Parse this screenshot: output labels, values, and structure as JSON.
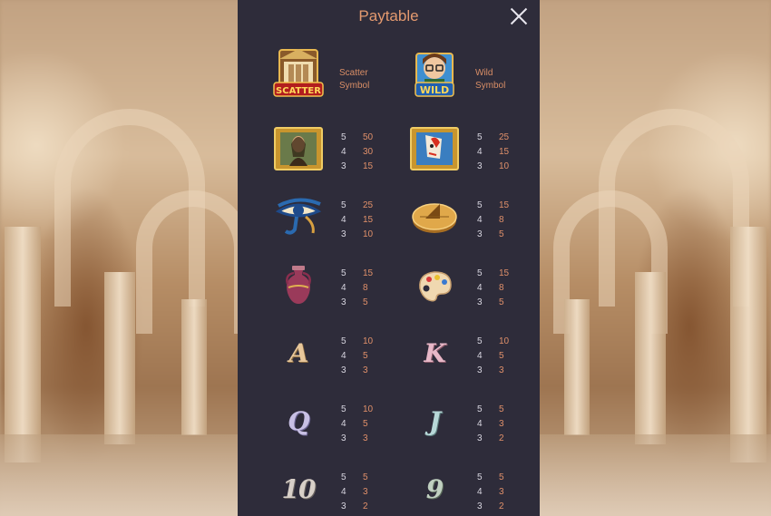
{
  "header": {
    "title": "Paytable"
  },
  "close_icon": "close-icon",
  "colors": {
    "panel": "#2e2c3a",
    "accent": "#e0906a",
    "count": "#d8d6e0"
  },
  "special": {
    "scatter": {
      "label": "SCATTER",
      "desc_line1": "Scatter",
      "desc_line2": "Symbol"
    },
    "wild": {
      "label": "WILD",
      "desc_line1": "Wild",
      "desc_line2": "Symbol"
    }
  },
  "symbols": [
    {
      "name": "mona-lisa-painting",
      "pays": [
        [
          "5",
          "50"
        ],
        [
          "4",
          "30"
        ],
        [
          "3",
          "15"
        ]
      ]
    },
    {
      "name": "abstract-portrait-painting",
      "pays": [
        [
          "5",
          "25"
        ],
        [
          "4",
          "15"
        ],
        [
          "3",
          "10"
        ]
      ]
    },
    {
      "name": "eye-of-horus",
      "pays": [
        [
          "5",
          "25"
        ],
        [
          "4",
          "15"
        ],
        [
          "3",
          "10"
        ]
      ]
    },
    {
      "name": "sundial",
      "pays": [
        [
          "5",
          "15"
        ],
        [
          "4",
          "8"
        ],
        [
          "3",
          "5"
        ]
      ]
    },
    {
      "name": "amphora-vase",
      "pays": [
        [
          "5",
          "15"
        ],
        [
          "4",
          "8"
        ],
        [
          "3",
          "5"
        ]
      ]
    },
    {
      "name": "paint-palette",
      "pays": [
        [
          "5",
          "15"
        ],
        [
          "4",
          "8"
        ],
        [
          "3",
          "5"
        ]
      ]
    },
    {
      "name": "A",
      "pays": [
        [
          "5",
          "10"
        ],
        [
          "4",
          "5"
        ],
        [
          "3",
          "3"
        ]
      ]
    },
    {
      "name": "K",
      "pays": [
        [
          "5",
          "10"
        ],
        [
          "4",
          "5"
        ],
        [
          "3",
          "3"
        ]
      ]
    },
    {
      "name": "Q",
      "pays": [
        [
          "5",
          "10"
        ],
        [
          "4",
          "5"
        ],
        [
          "3",
          "3"
        ]
      ]
    },
    {
      "name": "J",
      "pays": [
        [
          "5",
          "5"
        ],
        [
          "4",
          "3"
        ],
        [
          "3",
          "2"
        ]
      ]
    },
    {
      "name": "10",
      "pays": [
        [
          "5",
          "5"
        ],
        [
          "4",
          "3"
        ],
        [
          "3",
          "2"
        ]
      ]
    },
    {
      "name": "9",
      "pays": [
        [
          "5",
          "5"
        ],
        [
          "4",
          "3"
        ],
        [
          "3",
          "2"
        ]
      ]
    }
  ]
}
